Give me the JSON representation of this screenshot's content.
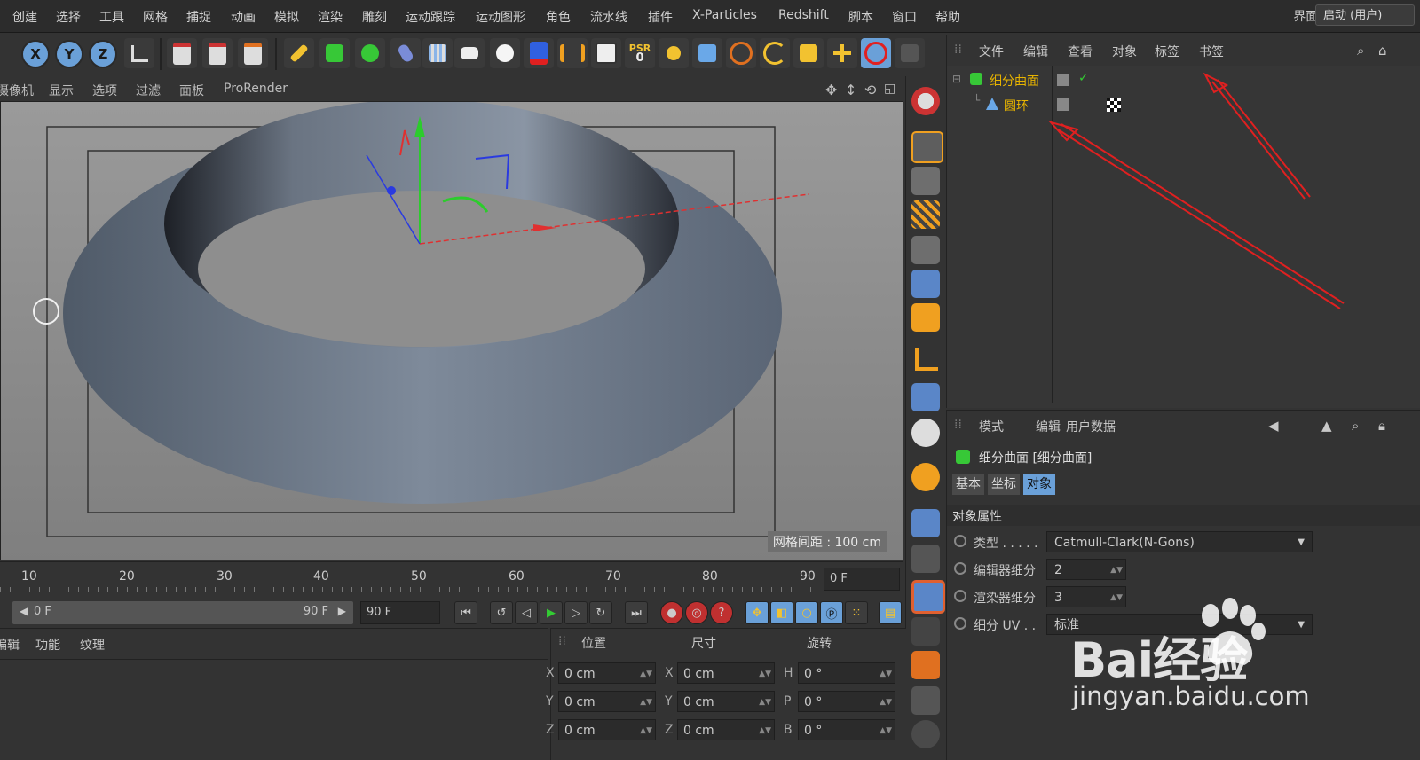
{
  "menubar": {
    "items": [
      "创建",
      "选择",
      "工具",
      "网格",
      "捕捉",
      "动画",
      "模拟",
      "渲染",
      "雕刻",
      "运动跟踪",
      "运动图形",
      "角色",
      "流水线",
      "插件",
      "X-Particles",
      "Redshift",
      "脚本",
      "窗口",
      "帮助"
    ],
    "layout_label": "界面:",
    "layout_value": "启动 (用户)"
  },
  "toolbar": {
    "axis_x": "X",
    "axis_y": "Y",
    "axis_z": "Z",
    "psr_label": "PSR",
    "psr_value": "0"
  },
  "viewport": {
    "menu": [
      "摄像机",
      "显示",
      "选项",
      "过滤",
      "面板",
      "ProRender"
    ],
    "grid_spacing": "网格间距 : 100 cm"
  },
  "object_manager": {
    "menu": [
      "文件",
      "编辑",
      "查看",
      "对象",
      "标签",
      "书签"
    ],
    "objects": [
      {
        "name": "细分曲面",
        "icon": "subdivision-surface-icon"
      },
      {
        "name": "圆环",
        "icon": "torus-icon"
      }
    ]
  },
  "attribute_manager": {
    "menu": [
      "模式",
      "编辑",
      "用户数据"
    ],
    "object_title": "细分曲面 [细分曲面]",
    "tabs": [
      "基本",
      "坐标",
      "对象"
    ],
    "active_tab": "对象",
    "section": "对象属性",
    "params": [
      {
        "label": "类型 . . . . .",
        "value": "Catmull-Clark(N-Gons)"
      },
      {
        "label": "编辑器细分",
        "value": "2"
      },
      {
        "label": "渲染器细分",
        "value": "3"
      },
      {
        "label": "细分 UV . .",
        "value": "标准"
      }
    ]
  },
  "timeline": {
    "ticks": [
      "10",
      "20",
      "30",
      "40",
      "50",
      "60",
      "70",
      "80",
      "90"
    ],
    "current_frame": "0 F",
    "range_start": "0 F",
    "range_end": "90 F",
    "end_frame": "90 F"
  },
  "material_menu": [
    "编辑",
    "功能",
    "纹理"
  ],
  "coordinates": {
    "headers": [
      "位置",
      "尺寸",
      "旋转"
    ],
    "rows": [
      {
        "pos_axis": "X",
        "pos": "0 cm",
        "size_axis": "X",
        "size": "0 cm",
        "rot_axis": "H",
        "rot": "0 °"
      },
      {
        "pos_axis": "Y",
        "pos": "0 cm",
        "size_axis": "Y",
        "size": "0 cm",
        "rot_axis": "P",
        "rot": "0 °"
      },
      {
        "pos_axis": "Z",
        "pos": "0 cm",
        "size_axis": "Z",
        "size": "0 cm",
        "rot_axis": "B",
        "rot": "0 °"
      }
    ]
  },
  "watermark": {
    "brand": "Bai经验",
    "url": "jingyan.baidu.com"
  },
  "colors": {
    "accent_blue": "#6aa0d8",
    "object_name": "#e8b400",
    "annotation_arrow": "#e02020"
  }
}
